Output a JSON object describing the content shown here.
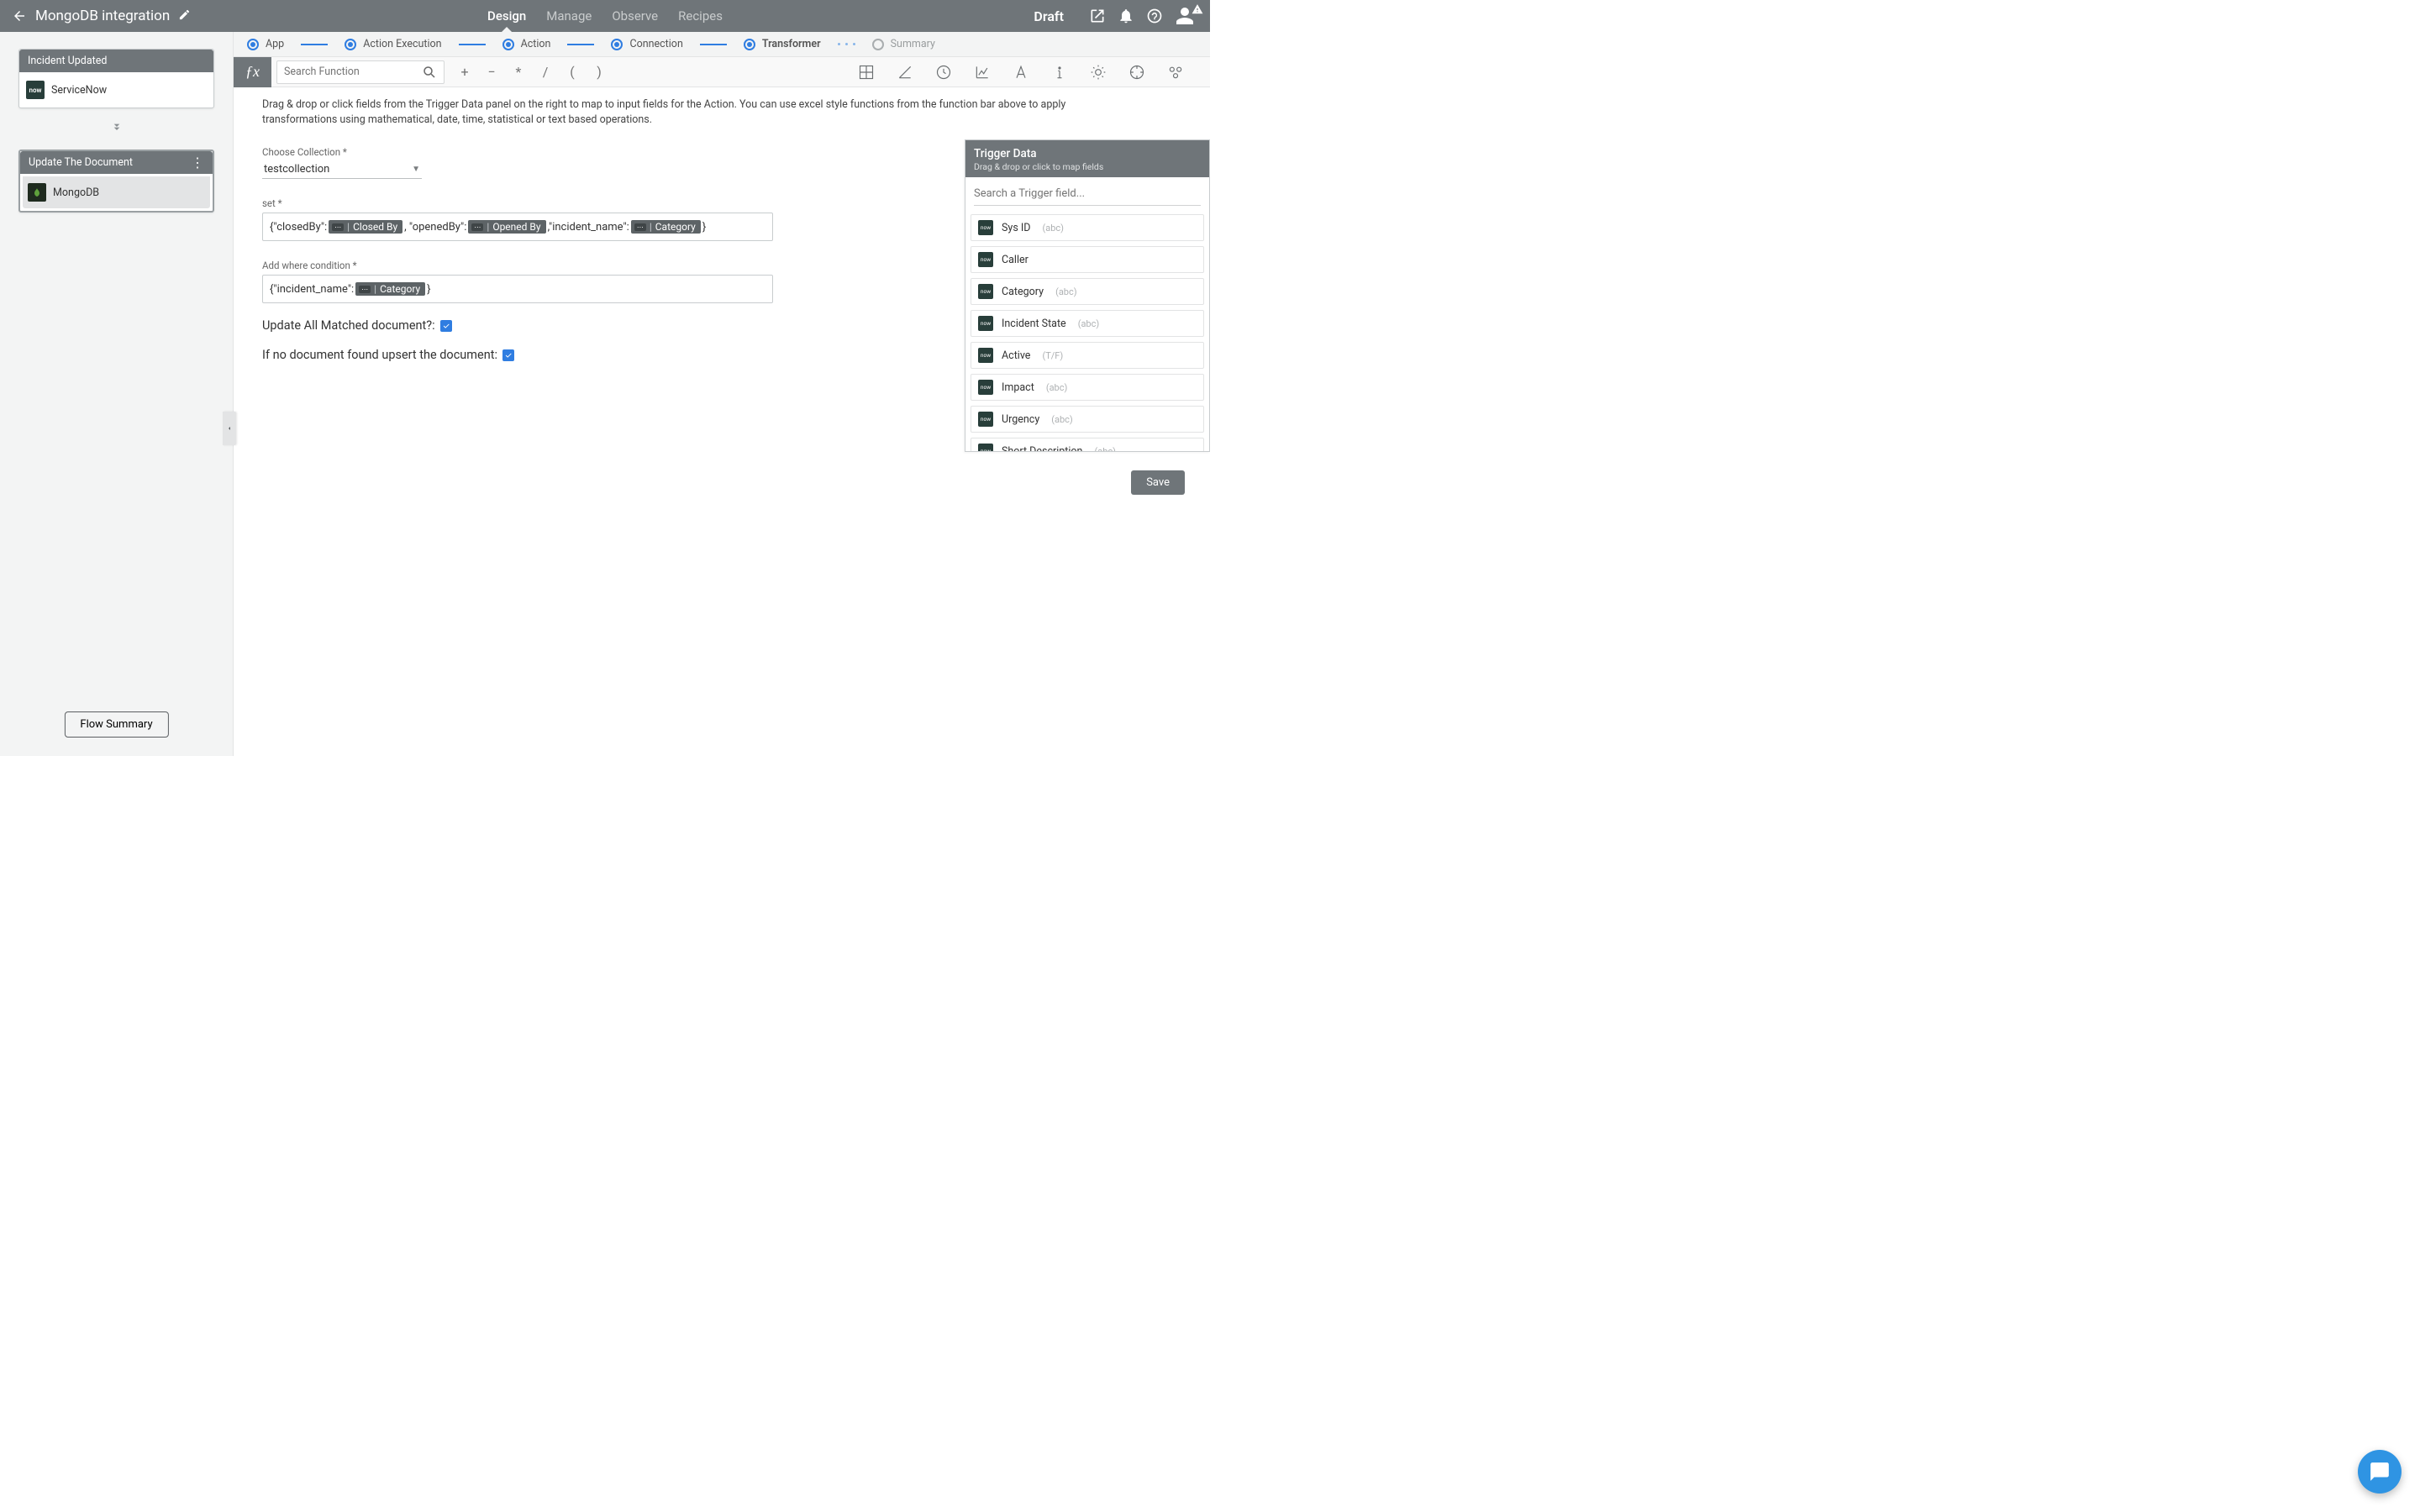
{
  "header": {
    "title": "MongoDB integration",
    "status": "Draft",
    "tabs": {
      "design": "Design",
      "manage": "Manage",
      "observe": "Observe",
      "recipes": "Recipes"
    }
  },
  "flow": {
    "trigger_card": {
      "title": "Incident Updated",
      "app": "ServiceNow"
    },
    "action_card": {
      "title": "Update The Document",
      "app": "MongoDB"
    },
    "summary_button": "Flow Summary"
  },
  "stepper": {
    "app": "App",
    "action_execution": "Action Execution",
    "action": "Action",
    "connection": "Connection",
    "transformer": "Transformer",
    "summary": "Summary"
  },
  "fnbar": {
    "search_placeholder": "Search Function",
    "ops": {
      "plus": "+",
      "minus": "−",
      "mult": "*",
      "div": "/",
      "lparen": "(",
      "rparen": ")"
    }
  },
  "hint": "Drag & drop or click fields from the Trigger Data panel on the right to map to input fields for the Action. You can use excel style functions from the function bar above to apply transformations using mathematical, date, time, statistical or text based operations.",
  "form": {
    "collection_label": "Choose Collection *",
    "collection_value": "testcollection",
    "set_label": "set *",
    "set_expr": {
      "p1": "{\"closedBy\":",
      "chip1": "Closed By",
      "p2": ", \"openedBy\":",
      "chip2": "Opened By",
      "p3": ",\"incident_name\":",
      "chip3": "Category",
      "p4": "}"
    },
    "where_label": "Add where condition *",
    "where_expr": {
      "p1": "{\"incident_name\":",
      "chip1": "Category",
      "p2": "}"
    },
    "update_all_label": "Update All Matched document?:",
    "upsert_label": "If no document found upsert the document:"
  },
  "trigger_panel": {
    "title": "Trigger Data",
    "subtitle": "Drag & drop or click to map fields",
    "search_placeholder": "Search a Trigger field...",
    "fields": [
      {
        "name": "Sys ID",
        "type": "(abc)"
      },
      {
        "name": "Caller",
        "type": ""
      },
      {
        "name": "Category",
        "type": "(abc)"
      },
      {
        "name": "Incident State",
        "type": "(abc)"
      },
      {
        "name": "Active",
        "type": "(T/F)"
      },
      {
        "name": "Impact",
        "type": "(abc)"
      },
      {
        "name": "Urgency",
        "type": "(abc)"
      },
      {
        "name": "Short Description",
        "type": "(abc)"
      }
    ]
  },
  "save_button": "Save"
}
